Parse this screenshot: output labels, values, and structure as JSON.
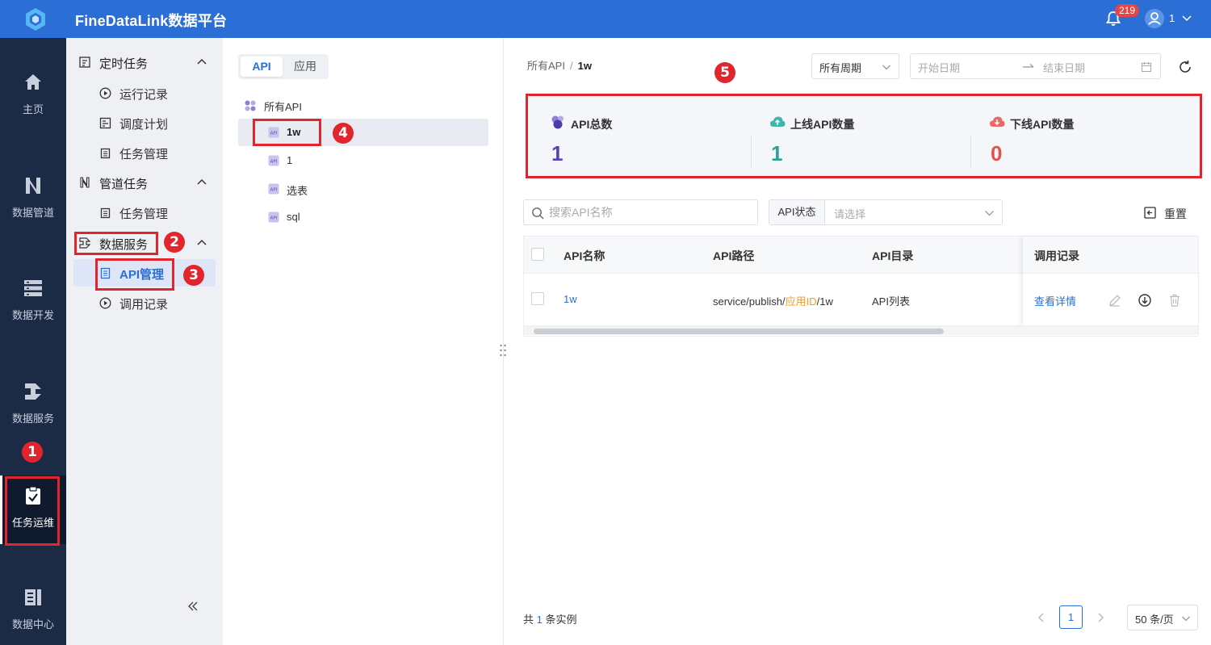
{
  "app": {
    "title": "FineDataLink数据平台",
    "notification_count": "219",
    "user_name": "1"
  },
  "rail": {
    "items": [
      {
        "label": "主页",
        "icon": "home-icon"
      },
      {
        "label": "数据管道",
        "icon": "pipeline-icon"
      },
      {
        "label": "数据开发",
        "icon": "dev-icon"
      },
      {
        "label": "数据服务",
        "icon": "service-icon"
      },
      {
        "label": "任务运维",
        "icon": "clipboard-check-icon",
        "active": true
      },
      {
        "label": "数据中心",
        "icon": "data-center-icon"
      }
    ]
  },
  "menu": {
    "groups": [
      {
        "label": "定时任务",
        "items": [
          "运行记录",
          "调度计划",
          "任务管理"
        ]
      },
      {
        "label": "管道任务",
        "items": [
          "任务管理"
        ]
      },
      {
        "label": "数据服务",
        "items": [
          "API管理",
          "调用记录"
        ]
      }
    ],
    "active_item": "API管理"
  },
  "tree": {
    "tabs": [
      "API",
      "应用"
    ],
    "root_label": "所有API",
    "items": [
      "1w",
      "1",
      "选表",
      "sql"
    ],
    "active_item": "1w"
  },
  "main": {
    "breadcrumb": {
      "parent": "所有API",
      "separator": "/",
      "current": "1w"
    },
    "period_select": "所有周期",
    "date_start_placeholder": "开始日期",
    "date_end_placeholder": "结束日期",
    "stats": [
      {
        "label": "API总数",
        "value": "1",
        "color": "#5b3fb7"
      },
      {
        "label": "上线API数量",
        "value": "1",
        "color": "#2aa198"
      },
      {
        "label": "下线API数量",
        "value": "0",
        "color": "#e2524b"
      }
    ],
    "search_placeholder": "搜索API名称",
    "status_filter": {
      "label": "API状态",
      "placeholder": "请选择"
    },
    "reset_label": "重置",
    "table": {
      "columns": [
        "API名称",
        "API路径",
        "API目录",
        "调用记录"
      ],
      "rows": [
        {
          "name": "1w",
          "path_prefix": "service/publish",
          "path_sep1": "/",
          "path_app": "应用ID",
          "path_sep2": "/",
          "path_suffix": "1w",
          "dir": "API列表",
          "action": "查看详情"
        }
      ]
    },
    "footer": {
      "total_prefix": "共",
      "total_count": "1",
      "total_suffix": "条实例",
      "current_page": "1",
      "page_size": "50 条/页"
    }
  },
  "annotations": [
    "1",
    "2",
    "3",
    "4",
    "5"
  ],
  "colors": {
    "brand": "#2b6fd6",
    "rail_bg": "#1b2a45",
    "annotation_red": "#e1252c"
  }
}
